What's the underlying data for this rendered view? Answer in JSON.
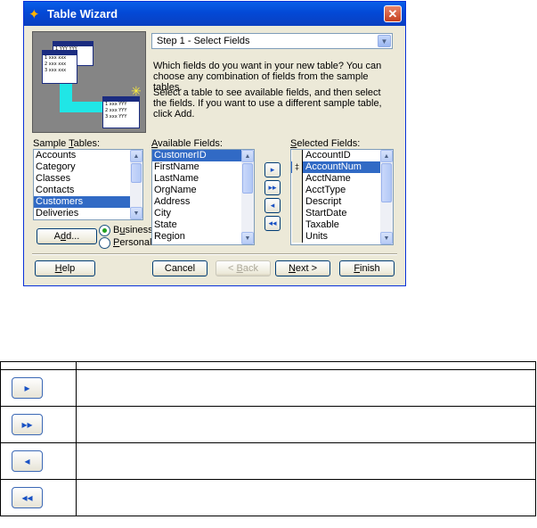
{
  "window": {
    "title": "Table Wizard",
    "close_glyph": "✕",
    "icon": "wizard-wand-icon"
  },
  "illustration": {
    "cards": [
      {
        "rows": [
          "1  YYY  YYY",
          "",
          ""
        ]
      },
      {
        "rows": [
          "1  xxx  xxx",
          "2  xxx  xxx",
          "3  xxx  xxx"
        ]
      },
      {
        "rows": [
          "1  xxx  YYY",
          "2  xxx  YYY",
          "3  xxx  YYY"
        ]
      }
    ]
  },
  "step": {
    "value": "Step 1 - Select Fields"
  },
  "description": {
    "para1": "Which fields do you want in your new table? You can choose any combination of fields from the sample tables.",
    "para2": "Select a table to see available fields, and then select the fields. If you want to use a different sample table, click Add."
  },
  "sample_tables": {
    "label_pre": "Sample ",
    "label_ul": "T",
    "label_post": "ables:",
    "items": [
      "Accounts",
      "Category",
      "Classes",
      "Contacts",
      "Customers",
      "Deliveries"
    ],
    "selected": "Customers"
  },
  "available_fields": {
    "label_ul": "A",
    "label_post": "vailable Fields:",
    "items": [
      "CustomerID",
      "FirstName",
      "LastName",
      "OrgName",
      "Address",
      "City",
      "State",
      "Region"
    ],
    "selected": "CustomerID"
  },
  "selected_fields": {
    "label_ul": "S",
    "label_post": "elected Fields:",
    "items": [
      "AccountID",
      "AccountNum",
      "AcctName",
      "AcctType",
      "Descript",
      "StartDate",
      "Taxable",
      "Units"
    ],
    "selected": "AccountNum",
    "move_marker": "‡"
  },
  "move_buttons": {
    "add_one": "▸",
    "add_all": "▸▸",
    "remove_one": "◂",
    "remove_all": "◂◂"
  },
  "add_button": {
    "pre": "A",
    "ul": "d",
    "post": "d..."
  },
  "radios": {
    "business": {
      "pre": "B",
      "ul": "u",
      "post": "siness"
    },
    "personal": {
      "pre": "",
      "ul": "P",
      "post": "ersonal"
    },
    "selected": "business"
  },
  "footer": {
    "help": {
      "ul": "H",
      "post": "elp"
    },
    "cancel": "Cancel",
    "back": {
      "pre": "< ",
      "ul": "B",
      "post": "ack"
    },
    "next": {
      "ul": "N",
      "post": "ext >"
    },
    "finish": {
      "ul": "F",
      "post": "inish"
    }
  },
  "legend": {
    "header": [
      "",
      ""
    ],
    "rows": [
      {
        "icon": "▸",
        "text": ""
      },
      {
        "icon": "▸▸",
        "text": ""
      },
      {
        "icon": "◂",
        "text": ""
      },
      {
        "icon": "◂◂",
        "text": ""
      }
    ]
  },
  "colors": {
    "title_bar": "#0349d6",
    "selection": "#316ac5",
    "dialog_bg": "#ece9d8",
    "illustration_cyan": "#20e6e6"
  }
}
